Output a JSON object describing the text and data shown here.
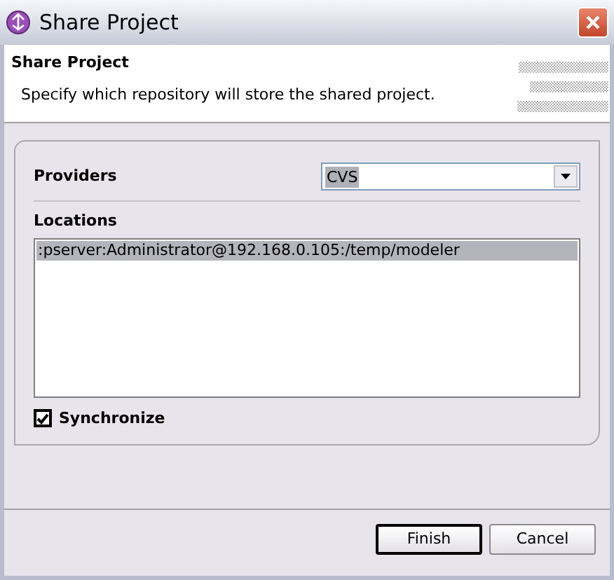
{
  "window": {
    "title": "Share Project"
  },
  "header": {
    "title": "Share Project",
    "description": "Specify which repository will store the shared project."
  },
  "providers": {
    "label": "Providers",
    "value": "CVS"
  },
  "locations": {
    "label": "Locations",
    "items": [
      {
        "text": ":pserver:Administrator@192.168.0.105:/temp/modeler",
        "selected": true
      }
    ]
  },
  "synchronize": {
    "label": "Synchronize",
    "checked": true
  },
  "buttons": [
    {
      "label": "Finish",
      "default": true
    },
    {
      "label": "Cancel",
      "default": false
    }
  ]
}
